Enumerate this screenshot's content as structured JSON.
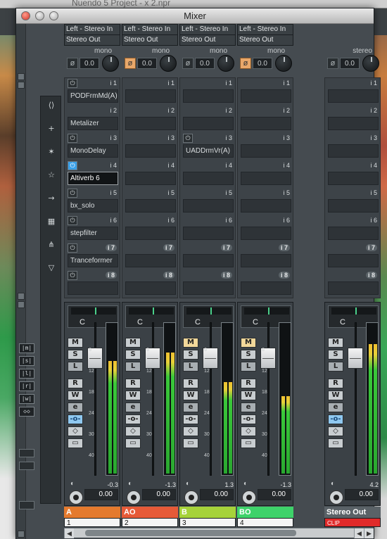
{
  "background_app": {
    "title": "Nuendo 5 Project - x 2.npr"
  },
  "window": {
    "title": "Mixer"
  },
  "tools_column": [
    "⟨⟩",
    "+",
    "✶",
    "☆",
    "→",
    "▦",
    "⋔",
    "▽"
  ],
  "side_buttons": [
    "|m|",
    "|s|",
    "|l|",
    "|r|",
    "|w|",
    "◇◇"
  ],
  "channels": [
    {
      "input": "Left - Stereo In",
      "output": "Stereo Out",
      "format": "mono",
      "gain": "0.0",
      "phase_on": false,
      "inserts": [
        {
          "slot": "i 1",
          "name": "PODFrmMd(A)",
          "power": "on"
        },
        {
          "slot": "i 2",
          "name": "Metalizer",
          "power": "none"
        },
        {
          "slot": "i 3",
          "name": "MonoDelay",
          "power": "off"
        },
        {
          "slot": "i 4",
          "name": "Altiverb 6",
          "power": "active",
          "selected": true
        },
        {
          "slot": "i 5",
          "name": "bx_solo",
          "power": "off"
        },
        {
          "slot": "i 6",
          "name": "stepfilter",
          "power": "off"
        },
        {
          "slot": "i 7",
          "name": "Tranceformer",
          "power": "off",
          "dark": true
        },
        {
          "slot": "i 8",
          "name": "",
          "power": "off",
          "dark": true
        }
      ],
      "pan": "C",
      "monitor_on": false,
      "read_on": false,
      "write_on": false,
      "peak": "-0.3",
      "volume": "0.00",
      "name": "A",
      "color": "#e47a2e",
      "number": "1"
    },
    {
      "input": "Left - Stereo In",
      "output": "Stereo Out",
      "format": "mono",
      "gain": "0.0",
      "phase_on": true,
      "inserts": [
        {
          "slot": "i 1",
          "name": ""
        },
        {
          "slot": "i 2",
          "name": ""
        },
        {
          "slot": "i 3",
          "name": ""
        },
        {
          "slot": "i 4",
          "name": ""
        },
        {
          "slot": "i 5",
          "name": ""
        },
        {
          "slot": "i 6",
          "name": ""
        },
        {
          "slot": "i 7",
          "name": "",
          "dark": true
        },
        {
          "slot": "i 8",
          "name": "",
          "dark": true
        }
      ],
      "pan": "C",
      "monitor_on": false,
      "peak": "-1.3",
      "volume": "0.00",
      "name": "AO",
      "color": "#e65a38",
      "number": "2"
    },
    {
      "input": "Left - Stereo In",
      "output": "Stereo Out",
      "format": "mono",
      "gain": "0.0",
      "phase_on": false,
      "inserts": [
        {
          "slot": "i 1",
          "name": ""
        },
        {
          "slot": "i 2",
          "name": ""
        },
        {
          "slot": "i 3",
          "name": "UADDrmVr(A)",
          "power": "off"
        },
        {
          "slot": "i 4",
          "name": ""
        },
        {
          "slot": "i 5",
          "name": ""
        },
        {
          "slot": "i 6",
          "name": ""
        },
        {
          "slot": "i 7",
          "name": "",
          "dark": true
        },
        {
          "slot": "i 8",
          "name": "",
          "dark": true
        }
      ],
      "pan": "C",
      "monitor_on": true,
      "peak": "1.3",
      "volume": "0.00",
      "name": "B",
      "color": "#a6d23a",
      "number": "3"
    },
    {
      "input": "Left - Stereo In",
      "output": "Stereo Out",
      "format": "mono",
      "gain": "0.0",
      "phase_on": true,
      "inserts": [
        {
          "slot": "i 1",
          "name": ""
        },
        {
          "slot": "i 2",
          "name": ""
        },
        {
          "slot": "i 3",
          "name": ""
        },
        {
          "slot": "i 4",
          "name": ""
        },
        {
          "slot": "i 5",
          "name": ""
        },
        {
          "slot": "i 6",
          "name": ""
        },
        {
          "slot": "i 7",
          "name": "",
          "dark": true
        },
        {
          "slot": "i 8",
          "name": "",
          "dark": true
        }
      ],
      "pan": "C",
      "monitor_on": true,
      "peak": "-1.3",
      "volume": "0.00",
      "name": "BO",
      "color": "#3ed26a",
      "number": "4"
    }
  ],
  "master": {
    "format": "stereo",
    "gain": "0.0",
    "pan": "C",
    "peak": "4.2",
    "volume": "0.00",
    "name": "Stereo Out",
    "clip": "CLIP",
    "inserts": [
      {
        "slot": "i 1"
      },
      {
        "slot": "i 2"
      },
      {
        "slot": "i 3"
      },
      {
        "slot": "i 4"
      },
      {
        "slot": "i 5"
      },
      {
        "slot": "i 6"
      },
      {
        "slot": "i 7",
        "dark": true
      },
      {
        "slot": "i 8",
        "dark": true
      }
    ]
  },
  "scale": [
    "6",
    "12",
    "18",
    "24",
    "30",
    "40"
  ],
  "levels": {
    "ch_left": [
      0.8,
      0.86,
      0.65,
      0.55
    ],
    "master": [
      0.92,
      0.92
    ]
  }
}
